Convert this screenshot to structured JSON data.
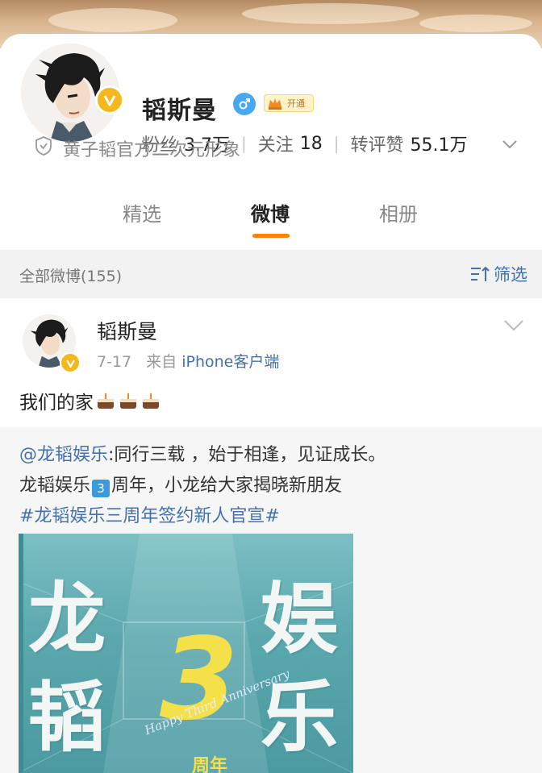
{
  "profile": {
    "name": "韬斯曼",
    "vip_label": "开通",
    "stats": {
      "fans_label": "粉丝",
      "fans_value": "3.7万",
      "follow_label": "关注",
      "follow_value": "18",
      "interact_label": "转评赞",
      "interact_value": "55.1万"
    },
    "description": "黄子韬官方二次元形象"
  },
  "tabs": [
    {
      "label": "精选"
    },
    {
      "label": "微博"
    },
    {
      "label": "相册"
    }
  ],
  "filter": {
    "count_label": "全部微博(155)",
    "filter_label": "筛选"
  },
  "post": {
    "author": "韬斯曼",
    "date": "7-17",
    "source_prefix": "来自",
    "source": "iPhone客户端",
    "text": "我们的家"
  },
  "repost": {
    "mention": "@龙韬娱乐",
    "line1_rest": ":同行三载 ，始于相逢，见证成长。",
    "line2_a": "龙韬娱乐",
    "line2_num": "3",
    "line2_b": "周年，小龙给大家揭晓新朋友",
    "hashtag": "#龙韬娱乐三周年签约新人官宣#",
    "poster": {
      "chars": [
        "龙",
        "韬",
        "娱",
        "乐"
      ],
      "number": "3",
      "foot": "周年",
      "script": "Happy Third Anniversary"
    }
  },
  "colors": {
    "accent_orange": "#ff8200",
    "link_blue": "#4470b0",
    "verified_gold": "#f5b81c",
    "gender_blue": "#47a8f5"
  }
}
